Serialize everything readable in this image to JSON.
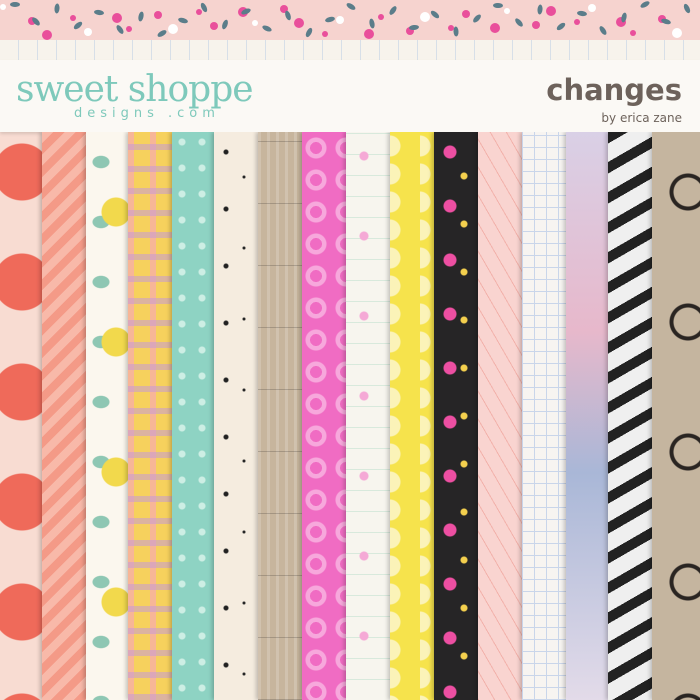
{
  "header": {
    "logo_main": "sweet shoppe",
    "logo_sub": "designs .com",
    "title": "changes",
    "subtitle": "by erica zane"
  },
  "colors": {
    "logo": "#7ec9bb",
    "title_text": "#6d625b",
    "banner_bg": "#fbf9f5",
    "top_floral_bg": "#f6d3cf",
    "pink_flower": "#e94f9b",
    "leaf": "#5b7d8a"
  },
  "papers": [
    {
      "id": "red-polka-circles",
      "pattern": "large-circles",
      "bg": "#f8dcd2",
      "accent": "#ef6a5a"
    },
    {
      "id": "coral-chevron",
      "pattern": "chevron",
      "bg": "#f49a87",
      "accent": "#f8b9a9"
    },
    {
      "id": "lemon-leaf-print",
      "pattern": "lemons-leaves",
      "bg": "#fbf7ee",
      "accent": "#f2d94c"
    },
    {
      "id": "pastel-plaid",
      "pattern": "plaid",
      "bg": "#f6d15d",
      "accent": "#c59ad6"
    },
    {
      "id": "mint-hearts",
      "pattern": "small-hearts",
      "bg": "#8ed3c3",
      "accent": "#cdeee4"
    },
    {
      "id": "ink-splatter",
      "pattern": "splatter",
      "bg": "#f5ecdf",
      "accent": "#222222"
    },
    {
      "id": "wood-planks",
      "pattern": "wood",
      "bg": "#c7b59d",
      "accent": "#e8ddcd"
    },
    {
      "id": "pink-circles",
      "pattern": "rings",
      "bg": "#f06cc3",
      "accent": "#f7a8dc"
    },
    {
      "id": "sketched-florals",
      "pattern": "sketch-flowers",
      "bg": "#f7f5ee",
      "accent": "#4cb48d"
    },
    {
      "id": "yellow-leaf-scallop",
      "pattern": "scallop",
      "bg": "#f6e34c",
      "accent": "#fbf3b8"
    },
    {
      "id": "dark-floral",
      "pattern": "dark-flowers",
      "bg": "#262526",
      "accent": "#ed4fa2"
    },
    {
      "id": "blush-herringbone",
      "pattern": "herringbone",
      "bg": "#f9d4d0",
      "accent": "#f2b2ab"
    },
    {
      "id": "graph-paper",
      "pattern": "grid",
      "bg": "#f7f4f1",
      "accent": "#c9d5ea"
    },
    {
      "id": "watercolor-wash",
      "pattern": "watercolor",
      "bg": "#c9c2dd",
      "accent": "#e7b8cb"
    },
    {
      "id": "black-white-brush",
      "pattern": "brush",
      "bg": "#efefef",
      "accent": "#222222"
    },
    {
      "id": "kraft-ink-circles",
      "pattern": "ink-rings",
      "bg": "#c5b59f",
      "accent": "#2a2522"
    }
  ]
}
